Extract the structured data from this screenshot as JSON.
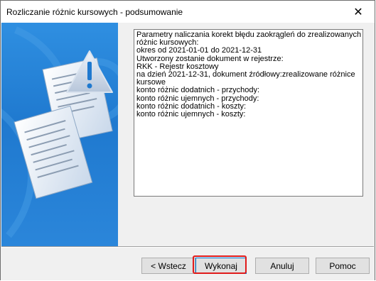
{
  "window": {
    "title": "Rozliczanie różnic kursowych - podsumowanie",
    "close_glyph": "✕"
  },
  "summary": {
    "lines": [
      "Parametry naliczania korekt błędu zaokrągleń do zrealizowanych",
      "różnic kursowych:",
      "okres od 2021-01-01 do 2021-12-31",
      "Utworzony zostanie dokument w rejestrze:",
      "RKK - Rejestr kosztowy",
      "na dzień 2021-12-31, dokument źródłowy:zrealizowane różnice",
      "kursowe",
      "konto różnic dodatnich - przychody:",
      "konto różnic ujemnych - przychody:",
      "konto różnic dodatnich - koszty:",
      "konto różnic ujemnych - koszty:"
    ]
  },
  "buttons": {
    "back": "< Wstecz",
    "execute": "Wykonaj",
    "cancel": "Anuluj",
    "help": "Pomoc"
  },
  "colors": {
    "banner": "#1f79cf",
    "highlight": "#e01b1b",
    "warning_icon": "#ffffff"
  },
  "icons": {
    "banner_graphic": "documents-with-warning-icon",
    "close": "close-icon"
  }
}
